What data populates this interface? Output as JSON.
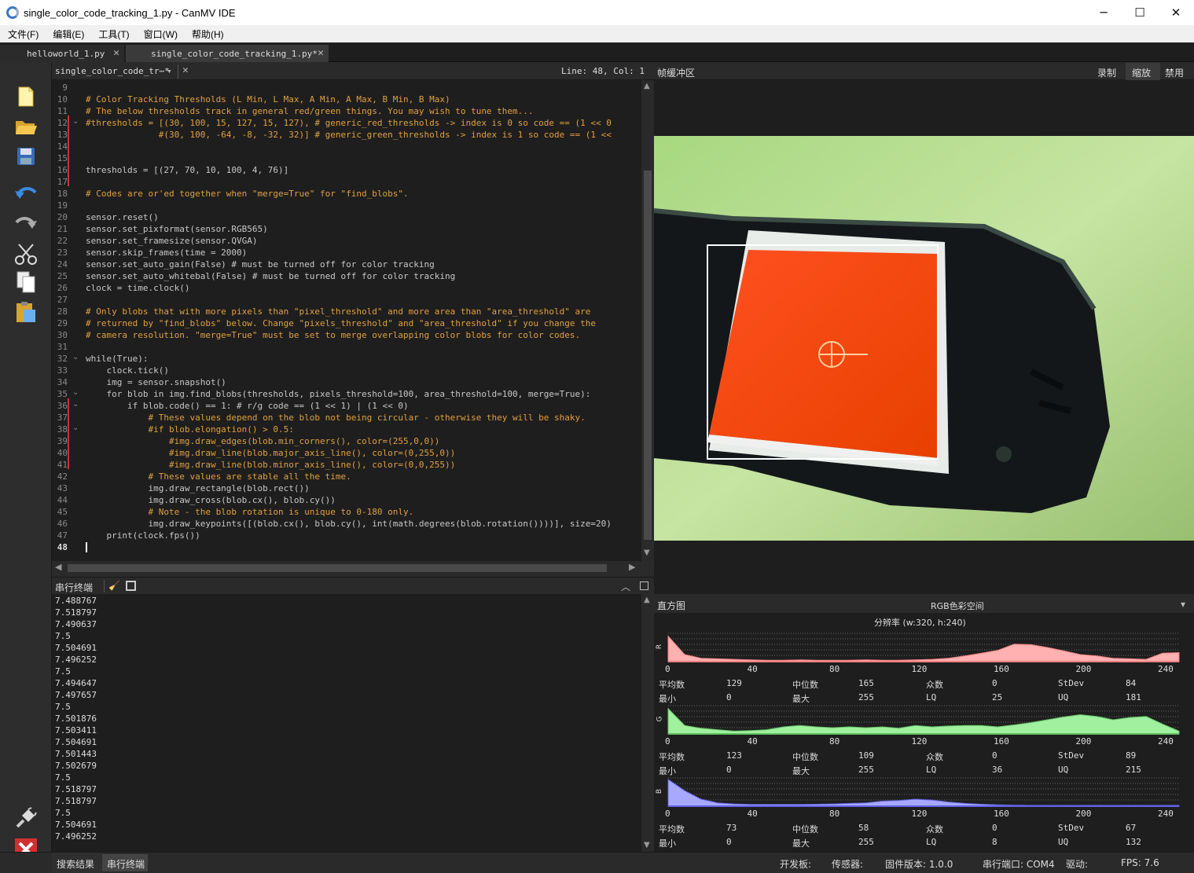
{
  "window": {
    "title": "single_color_code_tracking_1.py - CanMV IDE",
    "minimize": "─",
    "maximize": "☐",
    "close": "✕"
  },
  "menu": [
    "文件(F)",
    "编辑(E)",
    "工具(T)",
    "窗口(W)",
    "帮助(H)"
  ],
  "file_tabs": [
    {
      "label": "helloworld_1.py",
      "close": "✕"
    },
    {
      "label": "single_color_code_tracking_1.py*",
      "close": "✕"
    }
  ],
  "editor": {
    "doc_selector": "single_color_code_tr⋯*",
    "position": "Line: 48, Col: 1",
    "line_numbers": [
      "9",
      "10",
      "11",
      "12",
      "13",
      "14",
      "15",
      "16",
      "17",
      "18",
      "19",
      "20",
      "21",
      "22",
      "23",
      "24",
      "25",
      "26",
      "27",
      "28",
      "29",
      "30",
      "31",
      "32",
      "33",
      "34",
      "35",
      "36",
      "37",
      "38",
      "39",
      "40",
      "41",
      "42",
      "43",
      "44",
      "45",
      "46",
      "47",
      "48"
    ],
    "lines": [
      "",
      "# Color Tracking Thresholds (L Min, L Max, A Min, A Max, B Min, B Max)",
      "# The below thresholds track in general red/green things. You may wish to tune them...",
      "#thresholds = [(30, 100, 15, 127, 15, 127), # generic_red_thresholds -> index is 0 so code == (1 << 0",
      "              #(30, 100, -64, -8, -32, 32)] # generic_green_thresholds -> index is 1 so code == (1 <<",
      "",
      "",
      "thresholds = [(27, 70, 10, 100, 4, 76)]",
      "",
      "# Codes are or'ed together when \"merge=True\" for \"find_blobs\".",
      "",
      "sensor.reset()",
      "sensor.set_pixformat(sensor.RGB565)",
      "sensor.set_framesize(sensor.QVGA)",
      "sensor.skip_frames(time = 2000)",
      "sensor.set_auto_gain(False) # must be turned off for color tracking",
      "sensor.set_auto_whitebal(False) # must be turned off for color tracking",
      "clock = time.clock()",
      "",
      "# Only blobs that with more pixels than \"pixel_threshold\" and more area than \"area_threshold\" are",
      "# returned by \"find_blobs\" below. Change \"pixels_threshold\" and \"area_threshold\" if you change the",
      "# camera resolution. \"merge=True\" must be set to merge overlapping color blobs for color codes.",
      "",
      "while(True):",
      "    clock.tick()",
      "    img = sensor.snapshot()",
      "    for blob in img.find_blobs(thresholds, pixels_threshold=100, area_threshold=100, merge=True):",
      "        if blob.code() == 1: # r/g code == (1 << 1) | (1 << 0)",
      "            # These values depend on the blob not being circular - otherwise they will be shaky.",
      "            #if blob.elongation() > 0.5:",
      "                #img.draw_edges(blob.min_corners(), color=(255,0,0))",
      "                #img.draw_line(blob.major_axis_line(), color=(0,255,0))",
      "                #img.draw_line(blob.minor_axis_line(), color=(0,0,255))",
      "            # These values are stable all the time.",
      "            img.draw_rectangle(blob.rect())",
      "            img.draw_cross(blob.cx(), blob.cy())",
      "            # Note - the blob rotation is unique to 0-180 only.",
      "            img.draw_keypoints([(blob.cx(), blob.cy(), int(math.degrees(blob.rotation())))], size=20)",
      "    print(clock.fps())",
      ""
    ]
  },
  "terminal": {
    "title": "串行终端",
    "lines": [
      "7.488767",
      "7.518797",
      "7.490637",
      "7.5",
      "7.504691",
      "7.496252",
      "7.5",
      "7.494647",
      "7.497657",
      "7.5",
      "7.501876",
      "7.503411",
      "7.504691",
      "7.501443",
      "7.502679",
      "7.5",
      "7.518797",
      "7.518797",
      "7.5",
      "7.504691",
      "7.496252"
    ]
  },
  "framebuffer": {
    "title": "帧缓冲区",
    "record": "录制",
    "zoom": "缩放",
    "disable": "禁用"
  },
  "histogram": {
    "title": "直方图",
    "colorspace": "RGB色彩空间",
    "resolution": "分辨率 (w:320, h:240)",
    "ticks": [
      "0",
      "40",
      "80",
      "120",
      "160",
      "200",
      "240"
    ],
    "stat_labels": {
      "mean": "平均数",
      "median": "中位数",
      "mode": "众数",
      "stdev": "StDev",
      "min": "最小",
      "max": "最大",
      "lq": "LQ",
      "uq": "UQ"
    },
    "channels": [
      {
        "label": "R",
        "color": "#f08080",
        "fill": "#ffb0b0",
        "mean": "129",
        "median": "165",
        "mode": "0",
        "stdev": "84",
        "min": "0",
        "max": "255",
        "lq": "25",
        "uq": "181"
      },
      {
        "label": "G",
        "color": "#60c060",
        "fill": "#a0f0a0",
        "mean": "123",
        "median": "109",
        "mode": "0",
        "stdev": "89",
        "min": "0",
        "max": "255",
        "lq": "36",
        "uq": "215"
      },
      {
        "label": "B",
        "color": "#6060e0",
        "fill": "#a8a8ff",
        "mean": "73",
        "median": "58",
        "mode": "0",
        "stdev": "67",
        "min": "0",
        "max": "255",
        "lq": "8",
        "uq": "132"
      }
    ]
  },
  "bottom_tabs": {
    "search": "搜索结果",
    "serial": "串行终端"
  },
  "status": {
    "board": "开发板:",
    "sensor": "传感器:",
    "firmware": "固件版本: 1.0.0",
    "port": "串行端口: COM4",
    "driver": "驱动:",
    "fps": "FPS:  7.6"
  }
}
